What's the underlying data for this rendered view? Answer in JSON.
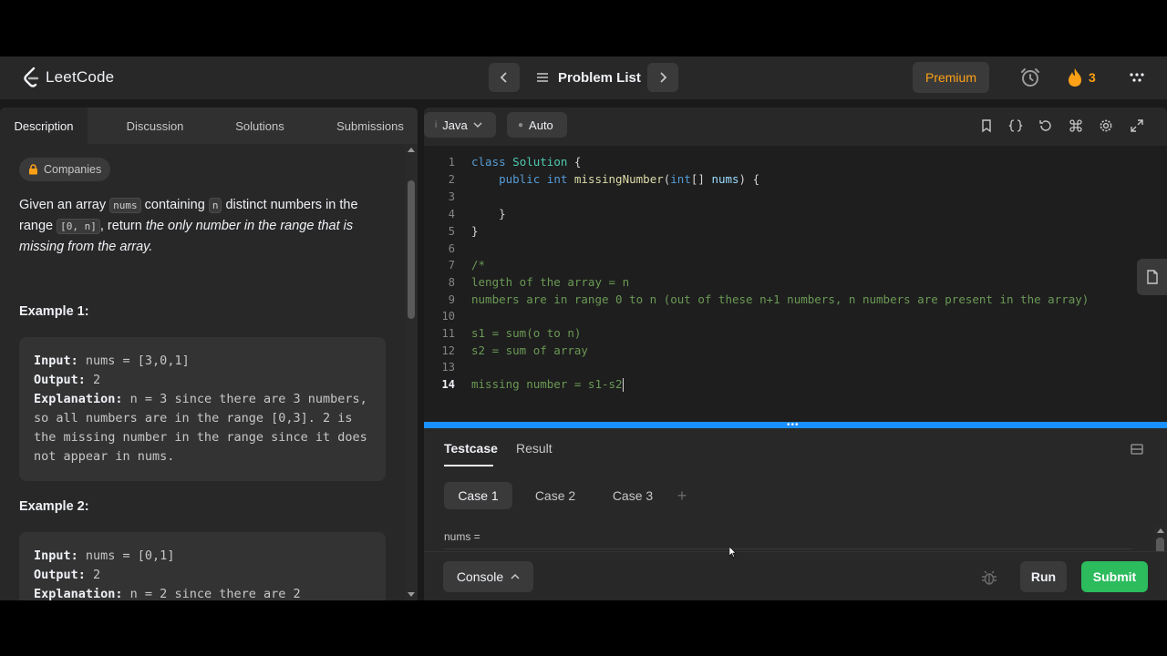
{
  "header": {
    "logo_text": "LeetCode",
    "problem_list": "Problem List",
    "premium": "Premium",
    "streak_count": "3"
  },
  "left": {
    "tabs": [
      "Description",
      "Discussion",
      "Solutions",
      "Submissions"
    ],
    "companies": "Companies",
    "statement": {
      "p1": "Given an array ",
      "code1": "nums",
      "p2": " containing ",
      "code2": "n",
      "p3": " distinct numbers in the range ",
      "code3": "[0, n]",
      "p4": ", return ",
      "em": "the only number in the range that is missing from the array."
    },
    "example1": {
      "title": "Example 1:",
      "input_label": "Input:",
      "input": " nums = [3,0,1]",
      "output_label": "Output:",
      "output": " 2",
      "explanation_label": "Explanation:",
      "explanation": " n = 3 since there are 3 numbers, so all numbers are in the range [0,3]. 2 is the missing number in the range since it does not appear in nums."
    },
    "example2": {
      "title": "Example 2:",
      "input_label": "Input:",
      "input": " nums = [0,1]",
      "output_label": "Output:",
      "output": " 2",
      "explanation_label": "Explanation:",
      "explanation": " n = 2 since there are 2"
    }
  },
  "editor": {
    "language": "Java",
    "mode": "Auto",
    "current_line": 14,
    "lines": [
      "class Solution {",
      "    public int missingNumber(int[] nums) {",
      "",
      "    }",
      "}",
      "",
      "/*",
      "length of the array = n",
      "numbers are in range 0 to n (out of these n+1 numbers, n numbers are present in the array)",
      "",
      "s1 = sum(o to n)",
      "s2 = sum of array",
      "",
      "missing number = s1-s2"
    ]
  },
  "bottom": {
    "tabs": [
      "Testcase",
      "Result"
    ],
    "cases": [
      "Case 1",
      "Case 2",
      "Case 3"
    ],
    "add_case": "+",
    "param_label": "nums =",
    "console": "Console",
    "run": "Run",
    "submit": "Submit"
  },
  "colors": {
    "accent_orange": "#ffa116",
    "submit_green": "#2cbb5d",
    "splitter_blue": "#1a90ff"
  }
}
